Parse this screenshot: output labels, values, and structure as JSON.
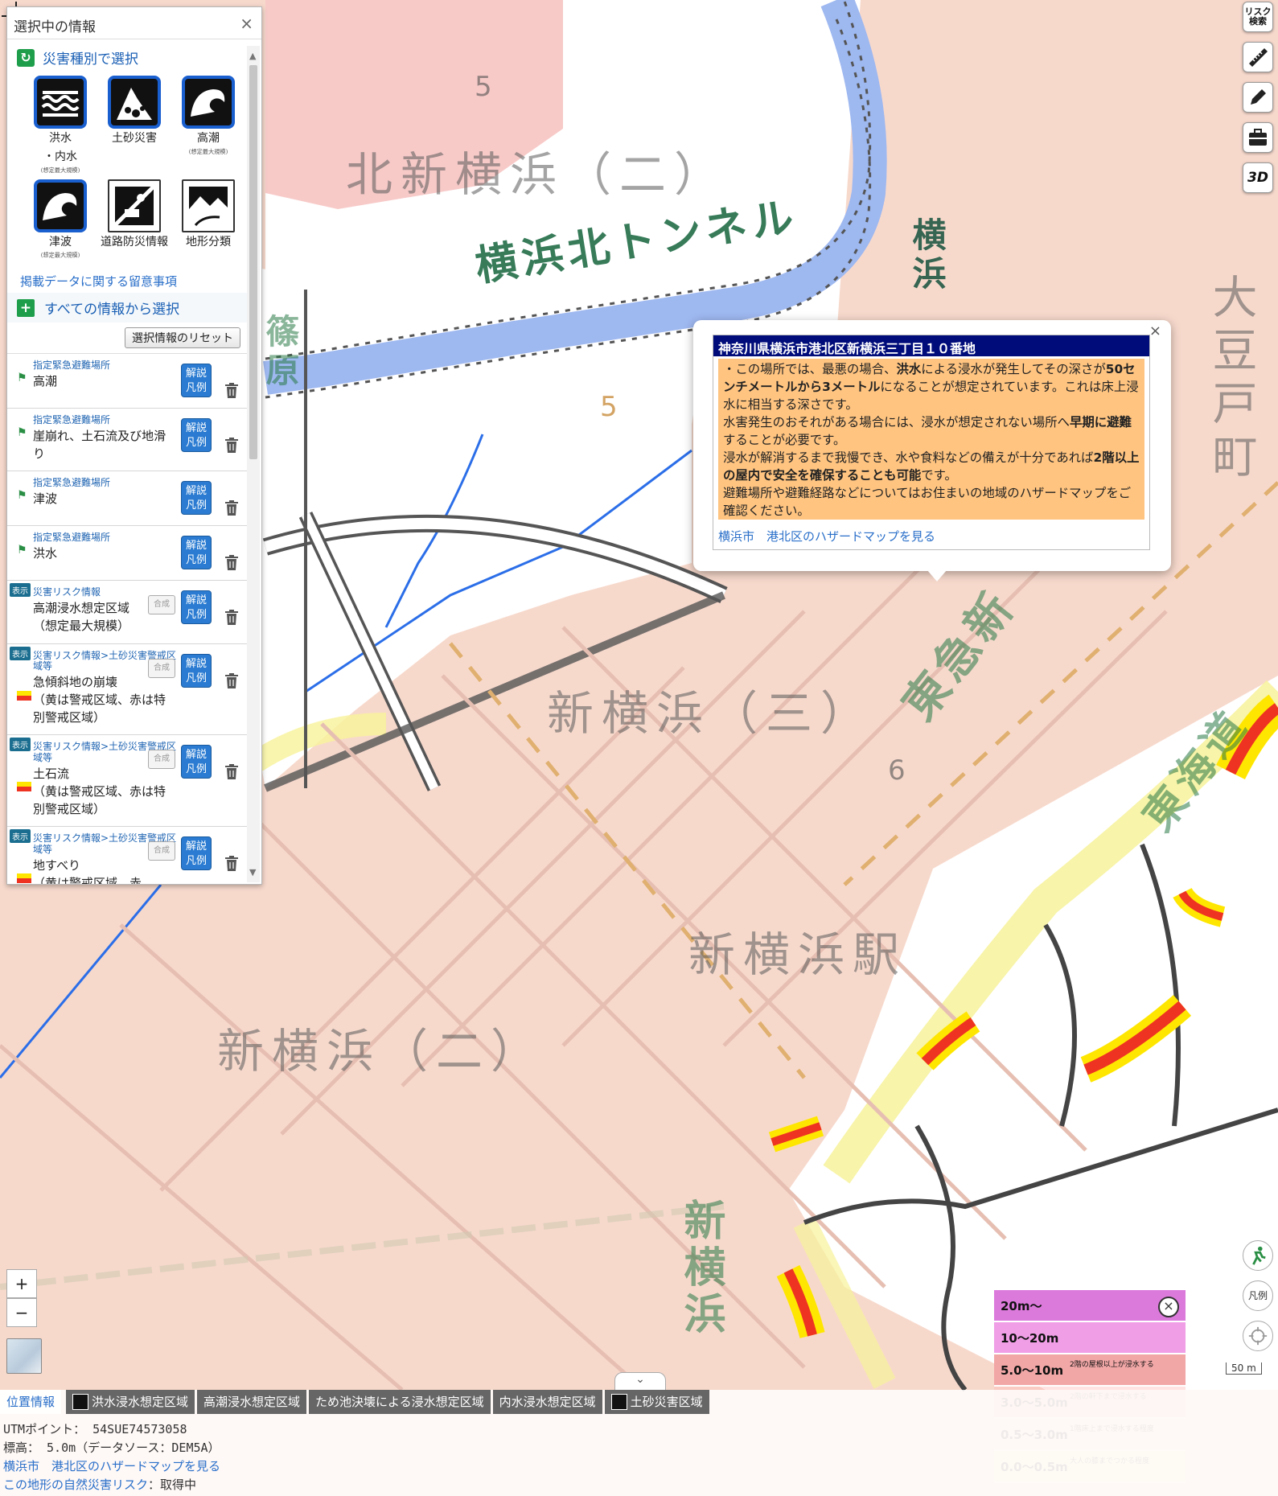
{
  "map": {
    "labels_big": [
      "北新横浜（二）",
      "新横浜（三）",
      "新横浜駅",
      "新横浜（二）"
    ],
    "labels_side": [
      "大豆戸町",
      "東急新",
      "東海道",
      "横浜北トンネル",
      "横浜",
      "篠原",
      "新横浜"
    ],
    "spot_heights": [
      "5",
      "5",
      "6"
    ]
  },
  "panel": {
    "title": "選択中の情報",
    "close": "×",
    "section_title": "災害種別で選択",
    "hazards": [
      {
        "label": "洪水",
        "label2": "・内水",
        "sub": "(想定最大規模)",
        "icon": "flood-icon"
      },
      {
        "label": "土砂災害",
        "label2": "",
        "sub": "",
        "icon": "landslide-icon"
      },
      {
        "label": "高潮",
        "label2": "",
        "sub": "(想定最大規模)",
        "icon": "storm-surge-icon"
      },
      {
        "label": "津波",
        "label2": "",
        "sub": "(想定最大規模)",
        "icon": "tsunami-icon"
      },
      {
        "label": "道路防災情報",
        "label2": "",
        "sub": "",
        "icon": "road-icon"
      },
      {
        "label": "地形分類",
        "label2": "",
        "sub": "",
        "icon": "terrain-icon"
      }
    ],
    "notice_link": "掲載データに関する留意事項",
    "all_select": "すべての情報から選択",
    "reset": "選択情報のリセット",
    "items": [
      {
        "cat": "指定緊急避難場所",
        "name": "高潮",
        "btn": [
          "解説",
          "凡例"
        ]
      },
      {
        "cat": "指定緊急避難場所",
        "name": "崖崩れ、土石流及び地滑り",
        "btn": [
          "解説",
          "凡例"
        ]
      },
      {
        "cat": "指定緊急避難場所",
        "name": "津波",
        "btn": [
          "解説",
          "凡例"
        ]
      },
      {
        "cat": "指定緊急避難場所",
        "name": "洪水",
        "btn": [
          "解説",
          "凡例"
        ]
      },
      {
        "disp": "表示",
        "cat": "災害リスク情報",
        "name": "高潮浸水想定区域\n（想定最大規模）",
        "gou": "合成",
        "btn": [
          "解説",
          "凡例"
        ]
      },
      {
        "disp": "表示",
        "cat": "災害リスク情報>土砂災害警戒区域等",
        "name": "急傾斜地の崩壊\n（黄は警戒区域、赤は特別警戒区域）",
        "gou": "合成",
        "btn": [
          "解説",
          "凡例"
        ]
      },
      {
        "disp": "表示",
        "cat": "災害リスク情報>土砂災害警戒区域等",
        "name": "土石流\n（黄は警戒区域、赤は特別警戒区域）",
        "gou": "合成",
        "btn": [
          "解説",
          "凡例"
        ]
      },
      {
        "disp": "表示",
        "cat": "災害リスク情報>土砂災害警戒区域等",
        "name": "地すべり\n（黄は警戒区域、赤",
        "gou": "合成",
        "btn": [
          "解説",
          "凡例"
        ]
      }
    ]
  },
  "popup": {
    "address": "神奈川県横浜市港北区新横浜三丁目１０番地",
    "p1a": "・この場所では、最悪の場合、",
    "p1b": "洪水",
    "p1c": "による浸水が発生してその深さが",
    "p1d": "50センチメートルから3メートル",
    "p1e": "になることが想定されています。これは床上浸水に相当する深さです。",
    "p2a": "水害発生のおそれがある場合には、浸水が想定されない場所へ",
    "p2b": "早期に避難",
    "p2c": "することが必要です。",
    "p3a": "浸水が解消するまで我慢でき、水や食料などの備えが十分であれば",
    "p3b": "2階以上の屋内で安全を確保することも可能",
    "p3c": "です。",
    "p4": "避難場所や避難経路などについてはお住まいの地域のハザードマップをご確認ください。",
    "link": "横浜市　港北区のハザードマップを見る",
    "close": "×"
  },
  "toolbar": {
    "risk": "リスク検索",
    "three_d": "3D"
  },
  "zoom": {
    "in": "+",
    "out": "−"
  },
  "legend": {
    "rows": [
      {
        "label": "20m～",
        "note": "",
        "color": "#dc7adc"
      },
      {
        "label": "10～20m",
        "note": "",
        "color": "#f09ee6"
      },
      {
        "label": "5.0～10m",
        "note": "2階の屋根以上が浸水する",
        "color": "#f2a7a7"
      },
      {
        "label": "3.0～5.0m",
        "note": "2階の軒下まで浸水する",
        "color": "#ffb2b2"
      },
      {
        "label": "0.5～3.0m",
        "note": "1階床上まで浸水する程度",
        "color": "#ffd9c9"
      },
      {
        "label": "0.0～0.5m",
        "note": "大人の膝までつかる程度",
        "color": "#f9f1b0"
      }
    ],
    "close": "×",
    "hanrei": "凡例",
    "scale": "50 m"
  },
  "bottom": {
    "tabs": [
      "位置情報",
      "洪水浸水想定区域",
      "高潮浸水想定区域",
      "ため池決壊による浸水想定区域",
      "内水浸水想定区域",
      "土砂災害区域"
    ],
    "utm": "UTMポイント： 54SUE74573058",
    "elev": "標高： 5.0m（データソース：DEM5A）",
    "hazard_link": "横浜市　港北区のハザードマップを見る",
    "terrain_a": "この地形の自然災害リスク",
    "terrain_b": "：取得中"
  }
}
